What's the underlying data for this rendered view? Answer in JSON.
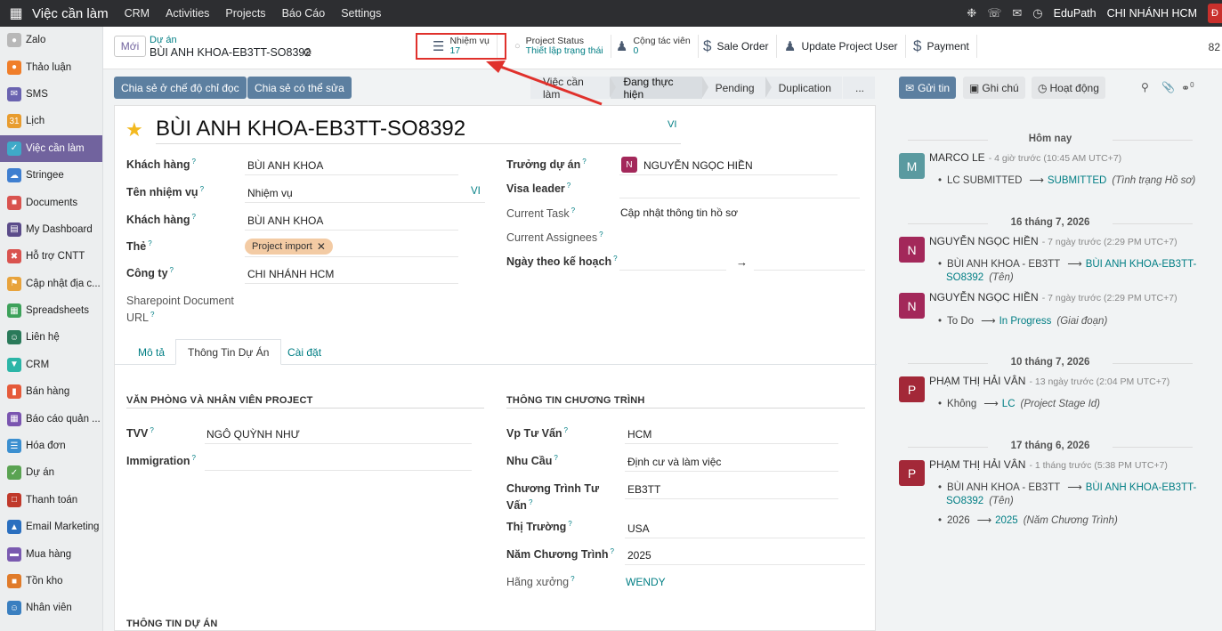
{
  "topbar": {
    "app_title": "Việc cần làm",
    "menus": [
      "CRM",
      "Activities",
      "Projects",
      "Báo Cáo",
      "Settings"
    ],
    "company_name": "EduPath",
    "branch": "CHI NHÁNH HCM",
    "user_initial": "Đ"
  },
  "sidebar": {
    "items": [
      {
        "label": "Zalo",
        "color": "#b8b8b8"
      },
      {
        "label": "Thảo luận",
        "color": "#f07e2a"
      },
      {
        "label": "SMS",
        "color": "#6a63b0"
      },
      {
        "label": "Lịch",
        "color": "#e89c2f"
      },
      {
        "label": "Việc cần làm",
        "color": "#3fa9c8"
      },
      {
        "label": "Stringee",
        "color": "#3f7fd0"
      },
      {
        "label": "Documents",
        "color": "#d9534f"
      },
      {
        "label": "My Dashboard",
        "color": "#5b4c8a"
      },
      {
        "label": "Hỗ trợ CNTT",
        "color": "#d9534f"
      },
      {
        "label": "Cập nhật địa c...",
        "color": "#e8a33c"
      },
      {
        "label": "Spreadsheets",
        "color": "#3da15a"
      },
      {
        "label": "Liên hệ",
        "color": "#2a7a5a"
      },
      {
        "label": "CRM",
        "color": "#2bb5a7"
      },
      {
        "label": "Bán hàng",
        "color": "#e55a3a"
      },
      {
        "label": "Báo cáo quản ...",
        "color": "#7a55b0"
      },
      {
        "label": "Hóa đơn",
        "color": "#3b8fd0"
      },
      {
        "label": "Dự án",
        "color": "#5aa352"
      },
      {
        "label": "Thanh toán",
        "color": "#c0392b"
      },
      {
        "label": "Email Marketing",
        "color": "#2a6fbf"
      },
      {
        "label": "Mua hàng",
        "color": "#7a5ab0"
      },
      {
        "label": "Tồn kho",
        "color": "#e07b2a"
      },
      {
        "label": "Nhân viên",
        "color": "#3a7fc0"
      }
    ]
  },
  "header": {
    "new_button": "Mới",
    "breadcrumb_parent": "Dự án",
    "breadcrumb_current": "BÙI ANH KHOA-EB3TT-SO8392",
    "smart_buttons": [
      {
        "title": "Nhiệm vụ",
        "value": "17"
      },
      {
        "title": "Project Status",
        "value": "Thiết lập trạng thái"
      },
      {
        "title": "Cộng tác viên",
        "value": "0"
      },
      {
        "title": "Sale Order"
      },
      {
        "title": "Update Project User"
      },
      {
        "title": "Payment"
      }
    ],
    "record_count": "82"
  },
  "actions": {
    "share_readonly": "Chia sẻ ở chế độ chỉ đọc",
    "share_edit": "Chia sẻ có thể sửa",
    "stages": [
      "Việc cần làm",
      "Đang thực hiện",
      "Pending",
      "Duplication",
      "..."
    ],
    "active_stage": "Đang thực hiện"
  },
  "form": {
    "title": "BÙI ANH KHOA-EB3TT-SO8392",
    "lang": "VI",
    "left_fields": [
      {
        "label": "Khách hàng",
        "value": "BÙI ANH KHOA"
      },
      {
        "label": "Tên nhiệm vụ",
        "value": "Nhiệm vụ"
      },
      {
        "label": "Khách hàng",
        "value": "BÙI ANH KHOA"
      },
      {
        "label": "Thẻ",
        "value": "Project import"
      },
      {
        "label": "Công ty",
        "value": "CHI NHÁNH HCM"
      },
      {
        "label": "Sharepoint Document URL",
        "value": ""
      }
    ],
    "right_fields": [
      {
        "label": "Trưởng dự án",
        "value": "NGUYỄN NGỌC HIỀN",
        "avatar": "N"
      },
      {
        "label": "Visa leader",
        "value": ""
      },
      {
        "label": "Current Task",
        "value": "Cập nhật thông tin hồ sơ"
      },
      {
        "label": "Current Assignees",
        "value": ""
      },
      {
        "label": "Ngày theo kế hoạch",
        "value": "→"
      }
    ],
    "tabs": [
      "Mô tả",
      "Thông Tin Dự Án",
      "Cài đặt"
    ],
    "section_left_title": "VĂN PHÒNG VÀ NHÂN VIÊN PROJECT",
    "section_left_fields": [
      {
        "label": "TVV",
        "value": "NGÔ QUỲNH NHƯ"
      },
      {
        "label": "Immigration",
        "value": ""
      }
    ],
    "section_right_title": "THÔNG TIN CHƯƠNG TRÌNH",
    "section_right_fields": [
      {
        "label": "Vp Tư Vấn",
        "value": "HCM"
      },
      {
        "label": "Nhu Cầu",
        "value": "Định cư và làm việc"
      },
      {
        "label": "Chương Trình Tư Vấn",
        "value": "EB3TT"
      },
      {
        "label": "Thị Trường",
        "value": "USA"
      },
      {
        "label": "Năm Chương Trình",
        "value": "2025"
      },
      {
        "label": "Hãng xưởng",
        "value": "WENDY"
      }
    ],
    "section_bottom_title": "THÔNG TIN DỰ ÁN"
  },
  "chatter": {
    "send_button": "Gửi tin",
    "note_button": "Ghi chú",
    "activity_button": "Hoạt động",
    "follower_count": "0",
    "groups": [
      {
        "date": "Hôm nay",
        "messages": [
          {
            "initial": "M",
            "color": "#5a9aa0",
            "author": "MARCO LE",
            "meta": "- 4 giờ trước (10:45 AM UTC+7)",
            "changes": [
              {
                "old": "LC SUBMITTED",
                "new": "SUBMITTED",
                "field": "(Tình trạng Hồ sơ)"
              }
            ]
          }
        ]
      },
      {
        "date": "16 tháng 7, 2026",
        "messages": [
          {
            "initial": "N",
            "color": "#a3285a",
            "author": "NGUYỄN NGỌC HIỀN",
            "meta": "- 7 ngày trước (2:29 PM UTC+7)",
            "changes": [
              {
                "old": "BÙI ANH KHOA - EB3TT",
                "new": "BÙI ANH KHOA-EB3TT-",
                "new2": "SO8392",
                "field": "(Tên)"
              }
            ]
          },
          {
            "initial": "N",
            "color": "#a3285a",
            "author": "NGUYỄN NGỌC HIỀN",
            "meta": "- 7 ngày trước (2:29 PM UTC+7)",
            "changes": [
              {
                "old": "To Do",
                "new": "In Progress",
                "field": "(Giai đoạn)"
              }
            ]
          }
        ]
      },
      {
        "date": "10 tháng 7, 2026",
        "messages": [
          {
            "initial": "P",
            "color": "#a32838",
            "author": "PHẠM THỊ HẢI VÂN",
            "meta": "- 13 ngày trước (2:04 PM UTC+7)",
            "changes": [
              {
                "old": "Không",
                "new": "LC",
                "field": "(Project Stage Id)"
              }
            ]
          }
        ]
      },
      {
        "date": "17 tháng 6, 2026",
        "messages": [
          {
            "initial": "P",
            "color": "#a32838",
            "author": "PHẠM THỊ HẢI VÂN",
            "meta": "- 1 tháng trước (5:38 PM UTC+7)",
            "changes": [
              {
                "old": "BÙI ANH KHOA - EB3TT",
                "new": "BÙI ANH KHOA-EB3TT-",
                "new2": "SO8392",
                "field": "(Tên)"
              },
              {
                "old": "2026",
                "new": "2025",
                "field": "(Năm Chương Trình)"
              }
            ]
          }
        ]
      }
    ]
  },
  "colors": {
    "brand": "#71639e",
    "topbar": "#2d2e31",
    "primary_button": "#5c7fa0",
    "link": "#017e84",
    "annotation_red": "#e0312c"
  }
}
